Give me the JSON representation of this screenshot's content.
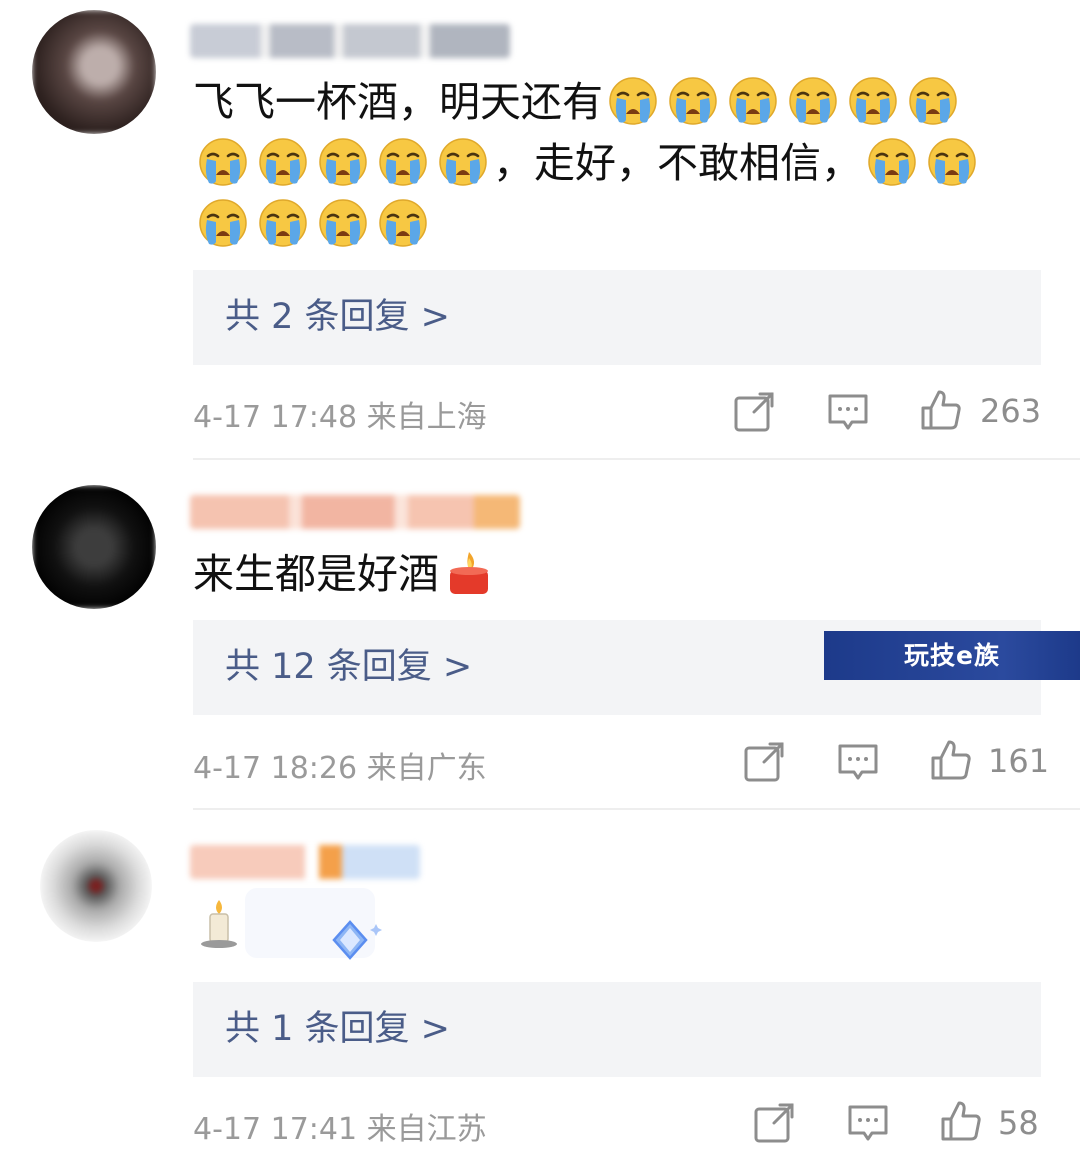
{
  "comments": [
    {
      "text_line1": "飞飞一杯酒，明天还有",
      "text_line2_mid": "，走好，不敢相信，",
      "reply_label": "共 2 条回复 >",
      "time_location": "4-17 17:48  来自上海",
      "like_count": "263"
    },
    {
      "text": "来生都是好酒",
      "reply_label": "共 12 条回复 >",
      "time_location": "4-17 18:26  来自广东",
      "like_count": "161"
    },
    {
      "reply_label": "共 1 条回复 >",
      "time_location": "4-17 17:41  来自江苏",
      "like_count": "58"
    }
  ],
  "watermark": "玩技e族",
  "icons": {
    "crying": "crying-face-icon",
    "candle_fire": "candle-fire-icon",
    "candle": "candle-icon",
    "diamond": "diamond-icon",
    "share": "share-icon",
    "comment": "comment-icon",
    "like": "like-icon"
  },
  "colors": {
    "reply_link": "#4a5c88",
    "meta": "#9a9a9a",
    "reply_bg": "#f3f4f6",
    "watermark_bg": "#1d3a8a"
  }
}
